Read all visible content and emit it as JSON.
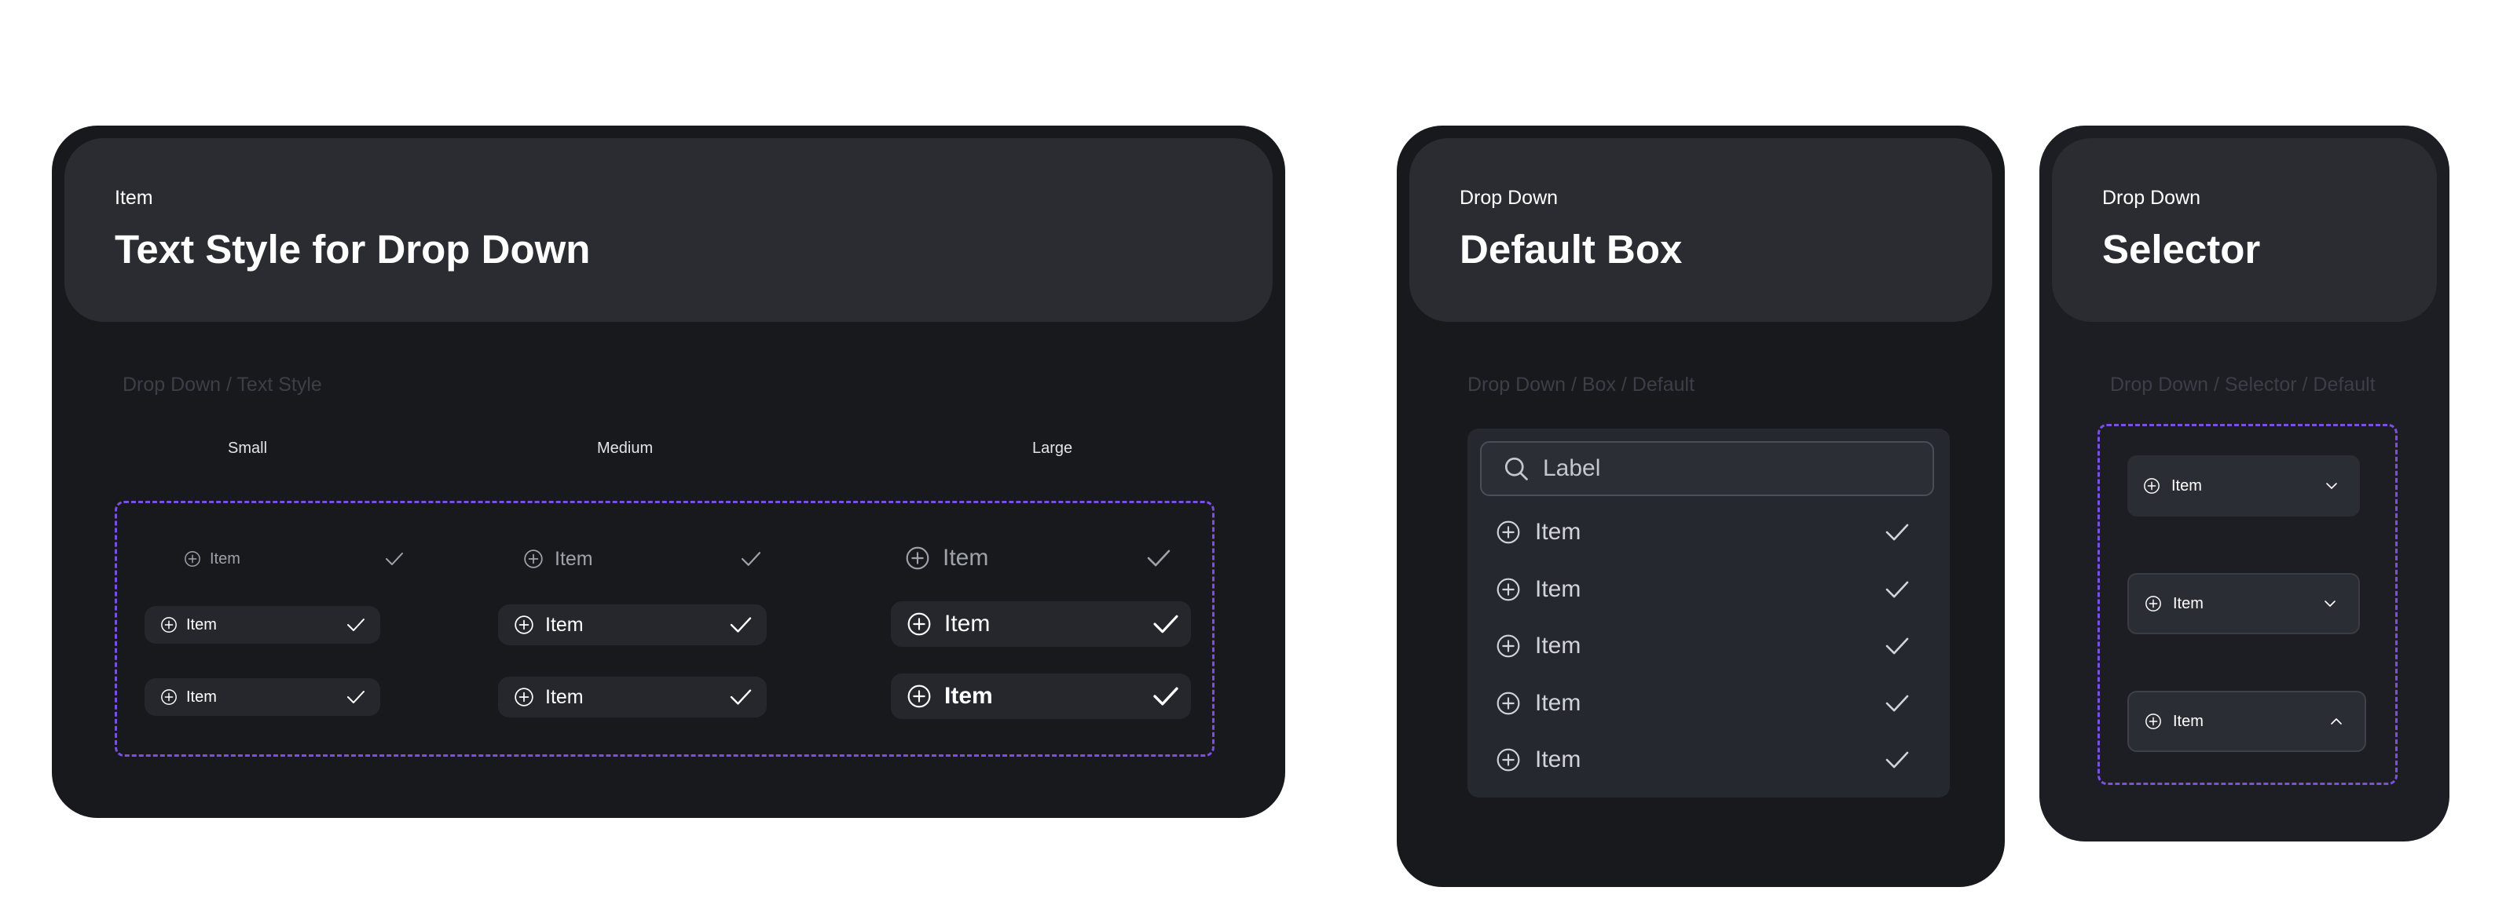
{
  "text_style_card": {
    "eyebrow": "Item",
    "title": "Text Style for Drop Down",
    "section_label": "Drop Down / Text Style",
    "columns": [
      "Small",
      "Medium",
      "Large"
    ],
    "rows": [
      {
        "small": "Item",
        "medium": "Item",
        "large": "Item"
      },
      {
        "small": "Item",
        "medium": "Item",
        "large": "Item"
      },
      {
        "small": "Item",
        "medium": "Item",
        "large": "Item"
      }
    ]
  },
  "default_box_card": {
    "eyebrow": "Drop Down",
    "title": "Default Box",
    "section_label": "Drop Down / Box / Default",
    "search_placeholder": "Label",
    "items": [
      "Item",
      "Item",
      "Item",
      "Item",
      "Item"
    ]
  },
  "selector_card": {
    "eyebrow": "Drop Down",
    "title": "Selector",
    "section_label": "Drop Down / Selector / Default",
    "items": [
      {
        "label": "Item",
        "chevron": "chevron-down-icon"
      },
      {
        "label": "Item",
        "chevron": "chevron-down-icon"
      },
      {
        "label": "Item",
        "chevron": "chevron-up-icon"
      }
    ]
  },
  "colors": {
    "page_background": "#ffffff",
    "card_background": "#18191d",
    "header_background": "#2b2c31",
    "accent_dashed": "#7b4fe2",
    "muted_text": "#3c3f47"
  }
}
